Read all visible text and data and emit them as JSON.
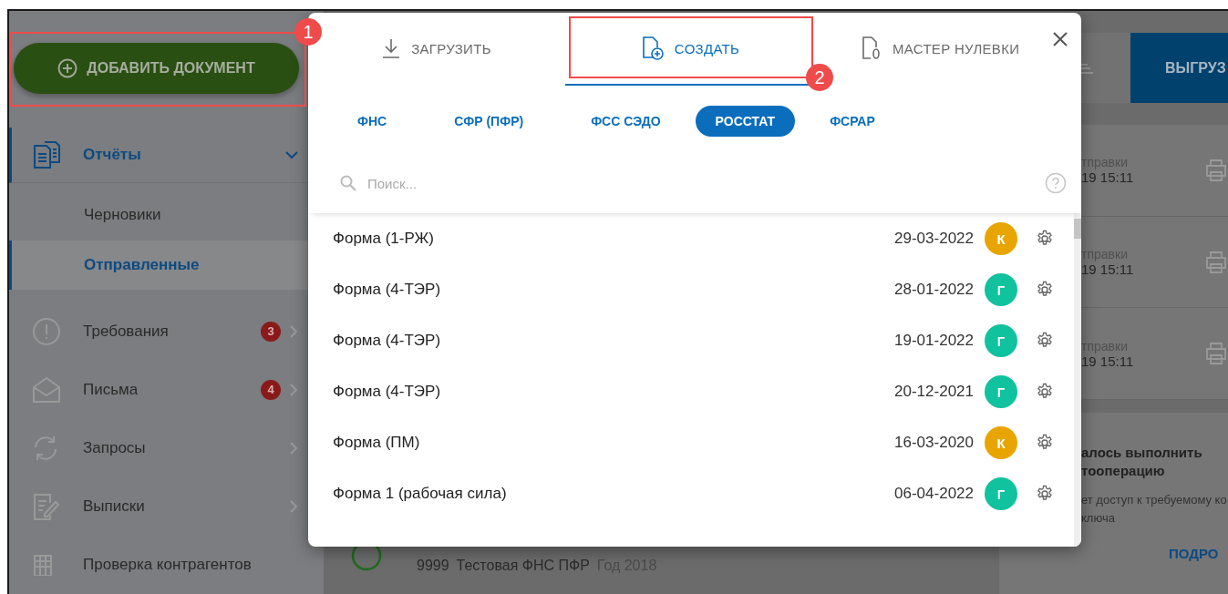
{
  "sidebar": {
    "add_button": "ДОБАВИТЬ ДОКУМЕНТ",
    "items": [
      {
        "label": "Отчёты",
        "expanded": true,
        "selected": true,
        "children": [
          {
            "label": "Черновики",
            "selected": false
          },
          {
            "label": "Отправленные",
            "selected": true
          }
        ]
      },
      {
        "label": "Требования",
        "badge": "3",
        "expanded": false,
        "selected": false
      },
      {
        "label": "Письма",
        "badge": "4",
        "expanded": false,
        "selected": false
      },
      {
        "label": "Запросы",
        "expanded": false,
        "selected": false
      },
      {
        "label": "Выписки",
        "expanded": false,
        "selected": false
      },
      {
        "label": "Проверка контрагентов",
        "selected": false
      }
    ]
  },
  "toolbar": {
    "export_button": "ВЫГРУЗ"
  },
  "sent_panel": {
    "rows": [
      {
        "label": "тправки",
        "time": "19 15:11"
      },
      {
        "label": "тправки",
        "time": "19 15:11"
      },
      {
        "label": "тправки",
        "time": "19 15:11"
      }
    ]
  },
  "notification": {
    "title": "алось выполнить",
    "title_2": "тооперацию",
    "text": "ет доступ к требуемому ко",
    "text_2": "ключа",
    "link": "ПОДРО"
  },
  "document_row": {
    "code": "9999",
    "name": "Тестовая ФНС ПФР",
    "period": "Год 2018"
  },
  "dialog": {
    "tabs": [
      {
        "label": "ЗАГРУЗИТЬ",
        "selected": false
      },
      {
        "label": "СОЗДАТЬ",
        "selected": true
      },
      {
        "label": "МАСТЕР НУЛЕВКИ",
        "selected": false
      }
    ],
    "categories": [
      {
        "label": "ФНС",
        "selected": false
      },
      {
        "label": "СФР (ПФР)",
        "selected": false
      },
      {
        "label": "ФСС СЭДО",
        "selected": false
      },
      {
        "label": "РОССТАТ",
        "selected": true
      },
      {
        "label": "ФСРАР",
        "selected": false
      }
    ],
    "search": {
      "placeholder": "Поиск..."
    },
    "forms": [
      {
        "name": "Форма (1-РЖ)",
        "date": "29-03-2022",
        "avatar": "К",
        "color": "#e8a500"
      },
      {
        "name": "Форма (4-ТЭР)",
        "date": "28-01-2022",
        "avatar": "Г",
        "color": "#10c29e"
      },
      {
        "name": "Форма (4-ТЭР)",
        "date": "19-01-2022",
        "avatar": "Г",
        "color": "#10c29e"
      },
      {
        "name": "Форма (4-ТЭР)",
        "date": "20-12-2021",
        "avatar": "Г",
        "color": "#10c29e"
      },
      {
        "name": "Форма (ПМ)",
        "date": "16-03-2020",
        "avatar": "К",
        "color": "#e8a500"
      },
      {
        "name": "Форма 1 (рабочая сила)",
        "date": "06-04-2022",
        "avatar": "Г",
        "color": "#10c29e"
      }
    ]
  },
  "annotations": [
    {
      "number": "1"
    },
    {
      "number": "2"
    }
  ]
}
